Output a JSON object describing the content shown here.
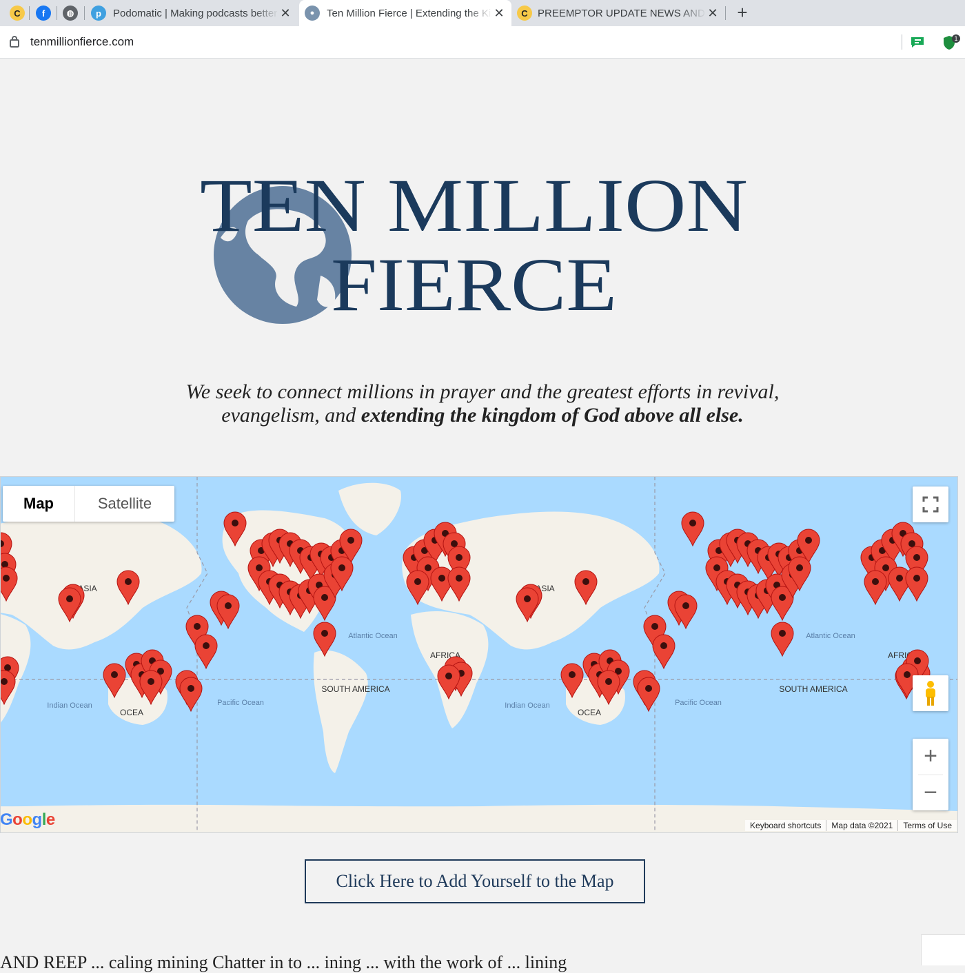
{
  "browser": {
    "tabs": [
      {
        "title": "Podomatic | Making podcasts better",
        "active": false
      },
      {
        "title": "Ten Million Fierce | Extending the Kingdom",
        "active": true
      },
      {
        "title": "PREEMPTOR UPDATE NEWS AND VIEWS",
        "active": false
      }
    ],
    "url": "tenmillionfierce.com",
    "extension_badge": "1"
  },
  "logo": {
    "line1": "TEN MILLION",
    "line2": "FIERCE"
  },
  "tagline": {
    "part1": "We seek to connect millions in prayer and the greatest efforts in revival,",
    "part2": "evangelism, and",
    "emphasis": "extending the kingdom of God above all else."
  },
  "map": {
    "type_map": "Map",
    "type_satellite": "Satellite",
    "labels": {
      "asia": "ASIA",
      "africa": "AFRICA",
      "south_america": "SOUTH AMERICA",
      "atlantic": "Atlantic Ocean",
      "pacific": "Pacific Ocean",
      "indian": "Indian Ocean",
      "oceania": "OCEA"
    },
    "attribution": {
      "shortcuts": "Keyboard shortcuts",
      "data": "Map data ©2021",
      "terms": "Terms of Use"
    },
    "google": "Google",
    "colors": {
      "water": "#aadaff",
      "land": "#f4f1e9",
      "pin": "#ea4335"
    }
  },
  "cta": {
    "add_yourself": "Click Here to Add Yourself to the Map"
  },
  "footer_partial_text": "AND REEP ... caling mining Chatter in to ... ining ... with the work of ... lining"
}
